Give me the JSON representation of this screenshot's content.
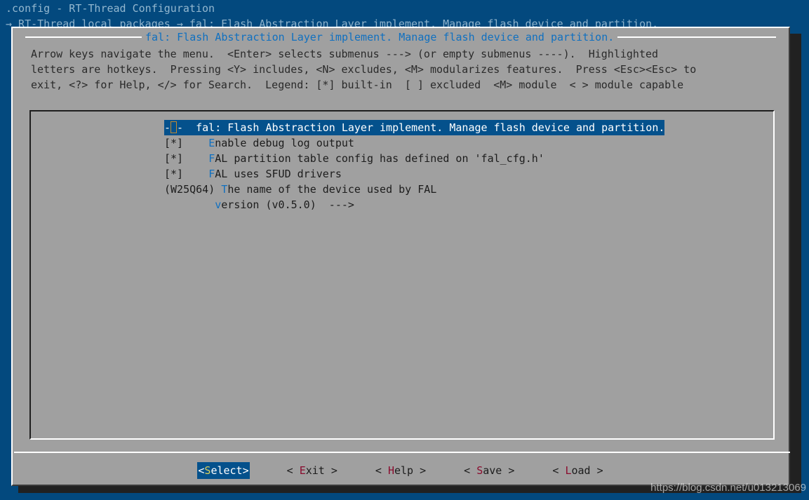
{
  "terminal": {
    "window_title": ".config - RT-Thread Configuration",
    "breadcrumb": "→ RT-Thread local packages → fal: Flash Abstraction Layer implement. Manage flash device and partition.",
    "background_color": "#03497e",
    "text_color": "#93b7cf"
  },
  "dialog": {
    "title": "fal: Flash Abstraction Layer implement. Manage flash device and partition.",
    "title_color": "#1070c0",
    "background_color": "#a0a0a0",
    "help_lines": [
      "Arrow keys navigate the menu.  <Enter> selects submenus ---> (or empty submenus ----).  Highlighted",
      "letters are hotkeys.  Pressing <Y> includes, <N> excludes, <M> modularizes features.  Press <Esc><Esc> to",
      "exit, <?> for Help, </> for Search.  Legend: [*] built-in  [ ] excluded  <M> module  < > module capable"
    ]
  },
  "menu": {
    "selected_index": 0,
    "highlight_color": "#04518c",
    "hotkey_color": "#1070c0",
    "cursor_color": "#c08a32",
    "items": [
      {
        "tag": "-*-",
        "tag_prefix": "-",
        "tag_suffix": "-",
        "has_cursor": true,
        "indent": "  ",
        "hotkey": "",
        "label": "fal: Flash Abstraction Layer implement. Manage flash device and partition.",
        "selected": true
      },
      {
        "tag": "[*]",
        "indent": "    ",
        "hotkey": "E",
        "label": "nable debug log output",
        "selected": false
      },
      {
        "tag": "[*]",
        "indent": "    ",
        "hotkey": "F",
        "label": "AL partition table config has defined on 'fal_cfg.h'",
        "selected": false
      },
      {
        "tag": "[*]",
        "indent": "    ",
        "hotkey": "F",
        "label": "AL uses SFUD drivers",
        "selected": false
      },
      {
        "tag": "(W25Q64)",
        "indent": " ",
        "hotkey": "T",
        "label": "he name of the device used by FAL",
        "selected": false
      },
      {
        "tag": "",
        "indent": "        ",
        "hotkey": "v",
        "label": "ersion (v0.5.0)  --->",
        "selected": false
      }
    ]
  },
  "buttons": [
    {
      "open": "<",
      "hotkey": "S",
      "rest": "elect",
      "close": ">",
      "spaced": false,
      "active": true
    },
    {
      "open": "<",
      "hotkey": "E",
      "rest": "xit",
      "close": ">",
      "spaced": true,
      "active": false
    },
    {
      "open": "<",
      "hotkey": "H",
      "rest": "elp",
      "close": ">",
      "spaced": true,
      "active": false
    },
    {
      "open": "<",
      "hotkey": "S",
      "rest": "ave",
      "close": ">",
      "spaced": true,
      "active": false
    },
    {
      "open": "<",
      "hotkey": "L",
      "rest": "oad",
      "close": ">",
      "spaced": true,
      "active": false
    }
  ],
  "watermark": "https://blog.csdn.net/u013213069"
}
